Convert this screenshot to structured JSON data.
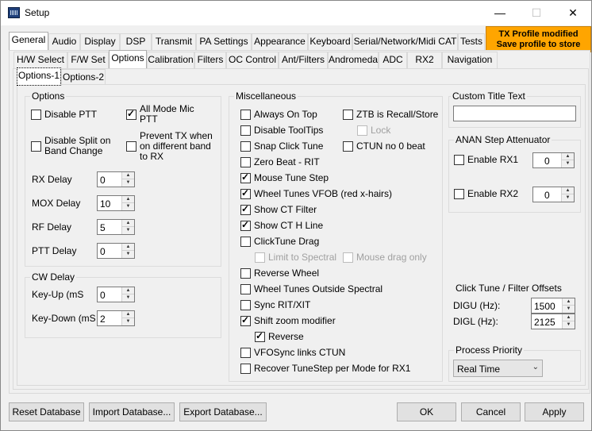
{
  "window": {
    "title": "Setup"
  },
  "main_tabs": [
    "General",
    "Audio",
    "Display",
    "DSP",
    "Transmit",
    "PA Settings",
    "Appearance",
    "Keyboard",
    "Serial/Network/Midi CAT",
    "Tests"
  ],
  "tx_profile": {
    "line1": "TX Profile modified",
    "line2": "Save profile to store"
  },
  "sub_tabs": [
    "H/W Select",
    "F/W Set",
    "Options",
    "Calibration",
    "Filters",
    "OC Control",
    "Ant/Filters",
    "Andromeda",
    "ADC",
    "RX2",
    "Navigation"
  ],
  "option_tabs": [
    "Options-1",
    "Options-2"
  ],
  "options_group": {
    "title": "Options",
    "disable_ptt": "Disable PTT",
    "all_mode_mic_ptt": "All Mode Mic PTT",
    "disable_split": "Disable Split on Band Change",
    "prevent_tx": "Prevent TX when on different band to RX",
    "rx_delay": {
      "label": "RX Delay",
      "value": "0"
    },
    "mox_delay": {
      "label": "MOX Delay",
      "value": "10"
    },
    "rf_delay": {
      "label": "RF Delay",
      "value": "5"
    },
    "ptt_delay": {
      "label": "PTT Delay",
      "value": "0"
    }
  },
  "cw_delay": {
    "title": "CW Delay",
    "key_up": {
      "label": "Key-Up (mS",
      "value": "0"
    },
    "key_down": {
      "label": "Key-Down (mS",
      "value": "2"
    }
  },
  "misc": {
    "title": "Miscellaneous",
    "always_on_top": "Always On Top",
    "disable_tooltips": "Disable ToolTips",
    "snap_click_tune": "Snap Click Tune",
    "zero_beat": "Zero Beat -  RIT",
    "mouse_tune_step": "Mouse Tune Step",
    "wheel_tunes_vfob": "Wheel Tunes VFOB (red x-hairs)",
    "show_ct_filter": "Show CT Filter",
    "show_ct_h_line": "Show CT H Line",
    "clicktune_drag": "ClickTune Drag",
    "limit_to_spectral": "Limit to Spectral",
    "mouse_drag_only": "Mouse drag only",
    "reverse_wheel": "Reverse Wheel",
    "wheel_tunes_outside": "Wheel Tunes Outside Spectral",
    "sync_rit_xit": "Sync RIT/XIT",
    "shift_zoom": "Shift zoom modifier",
    "reverse": "Reverse",
    "vfosync": "VFOSync links CTUN",
    "recover_tunestep": "Recover TuneStep per Mode for RX1",
    "ztb_recall": "ZTB is Recall/Store",
    "lock": "Lock",
    "ctun_no_beat": "CTUN no 0 beat"
  },
  "custom_title": {
    "title": "Custom Title Text",
    "value": ""
  },
  "step_att": {
    "title": "ANAN Step Attenuator",
    "rx1": {
      "label": "Enable RX1",
      "value": "0"
    },
    "rx2": {
      "label": "Enable RX2",
      "value": "0"
    }
  },
  "click_tune": {
    "title": "Click Tune / Filter Offsets",
    "digu": {
      "label": "DIGU (Hz):",
      "value": "1500"
    },
    "digl": {
      "label": "DIGL (Hz):",
      "value": "2125"
    }
  },
  "process_priority": {
    "title": "Process Priority",
    "value": "Real Time"
  },
  "buttons": {
    "reset_db": "Reset Database",
    "import_db": "Import Database...",
    "export_db": "Export Database...",
    "ok": "OK",
    "cancel": "Cancel",
    "apply": "Apply"
  }
}
